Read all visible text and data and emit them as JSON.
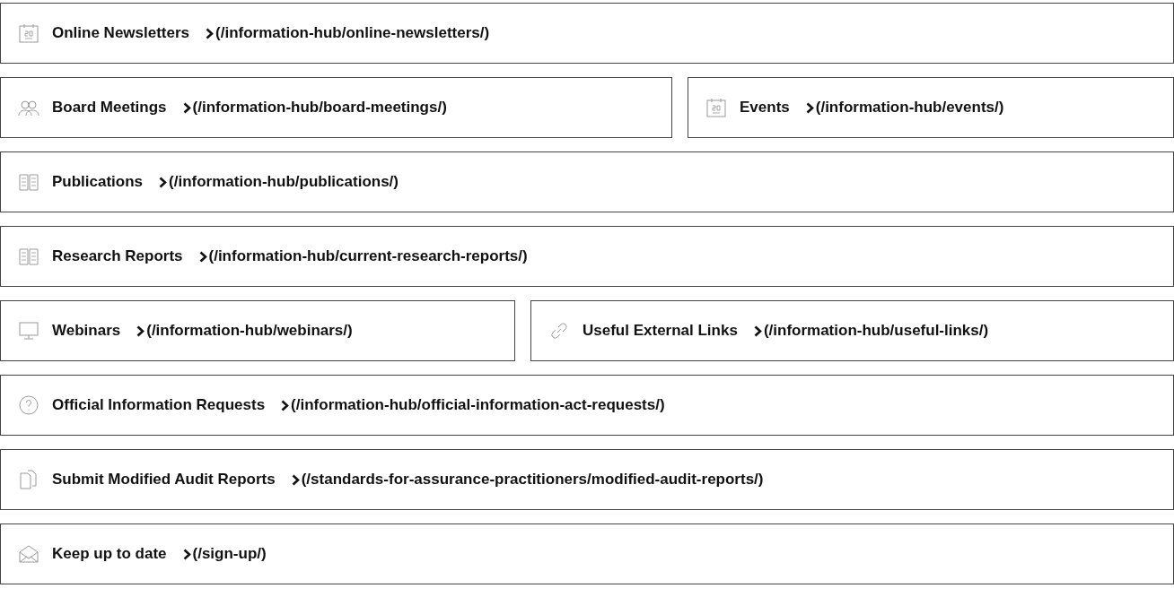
{
  "rows": [
    [
      {
        "title": "Online Newsletters",
        "path": "(/information-hub/online-newsletters/)"
      }
    ],
    [
      {
        "title": "Board Meetings",
        "path": "(/information-hub/board-meetings/)"
      },
      {
        "title": "Events",
        "path": "(/information-hub/events/)"
      }
    ],
    [
      {
        "title": "Publications",
        "path": "(/information-hub/publications/)"
      }
    ],
    [
      {
        "title": "Research Reports",
        "path": "(/information-hub/current-research-reports/)"
      }
    ],
    [
      {
        "title": "Webinars",
        "path": "(/information-hub/webinars/)"
      },
      {
        "title": "Useful External Links",
        "path": "(/information-hub/useful-links/)"
      }
    ],
    [
      {
        "title": "Official Information Requests",
        "path": "(/information-hub/official-information-act-requests/)"
      }
    ],
    [
      {
        "title": "Submit Modified Audit Reports",
        "path": "(/standards-for-assurance-practitioners/modified-audit-reports/)"
      }
    ],
    [
      {
        "title": "Keep up to date",
        "path": "(/sign-up/)"
      }
    ]
  ]
}
